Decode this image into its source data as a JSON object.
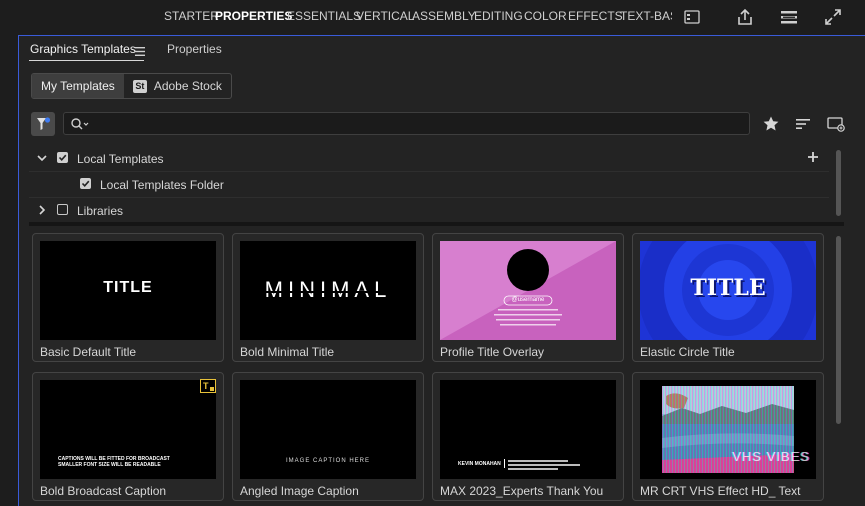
{
  "workspaces": {
    "tabs": [
      {
        "label": "STARTER",
        "active": false
      },
      {
        "label": "PROPERTIES",
        "active": true
      },
      {
        "label": "ESSENTIALS",
        "active": false
      },
      {
        "label": "VERTICAL",
        "active": false
      },
      {
        "label": "ASSEMBLY",
        "active": false
      },
      {
        "label": "EDITING",
        "active": false
      },
      {
        "label": "COLOR",
        "active": false
      },
      {
        "label": "EFFECTS",
        "active": false
      },
      {
        "label": "TEXT-BASED EDITING",
        "active": false
      }
    ],
    "icons": [
      "panel-menu-icon",
      "share-icon",
      "workspace-menu-icon",
      "fullscreen-icon"
    ]
  },
  "panel": {
    "tabs": [
      {
        "label": "Graphics Templates",
        "active": true
      },
      {
        "label": "Properties",
        "active": false
      }
    ],
    "tab_menu_icon": "hamburger-icon"
  },
  "source_toggle": {
    "my_templates": "My Templates",
    "adobe_stock_badge": "St",
    "adobe_stock": "Adobe Stock",
    "selected": "My Templates"
  },
  "search": {
    "value": "",
    "placeholder": "",
    "tools": [
      "star-icon",
      "sort-icon",
      "new-folder-icon"
    ]
  },
  "tree": {
    "local_templates": {
      "label": "Local Templates",
      "checked": true,
      "expanded": true
    },
    "local_templates_folder": {
      "label": "Local Templates Folder",
      "checked": true
    },
    "libraries": {
      "label": "Libraries",
      "checked": false,
      "expanded": false
    }
  },
  "templates": [
    {
      "name": "Basic Default Title",
      "thumb_text": "TITLE"
    },
    {
      "name": "Bold Minimal Title",
      "thumb_text": "MINIMAL"
    },
    {
      "name": "Profile Title Overlay",
      "thumb_text": "@username"
    },
    {
      "name": "Elastic Circle Title",
      "thumb_text": "TITLE"
    },
    {
      "name": "Bold Broadcast Caption",
      "thumb_text": "CAPTIONS WILL BE FITTED FOR BROADCAST\nSMALLER FONT SIZE WILL BE READABLE"
    },
    {
      "name": "Angled Image Caption",
      "thumb_text": "IMAGE CAPTION HERE"
    },
    {
      "name": "MAX 2023_Experts Thank You",
      "thumb_text": "KEVIN MONAHAN"
    },
    {
      "name": "MR CRT VHS Effect HD_ Text",
      "thumb_text": "VHS VIBES"
    }
  ],
  "colors": {
    "accent": "#3a5bd9",
    "panel_bg": "#232323",
    "card_bg": "#272727",
    "profile_pink": "#d77fcf",
    "elastic_blue": "#1e34d6",
    "badge_yellow": "#e8c23a"
  }
}
